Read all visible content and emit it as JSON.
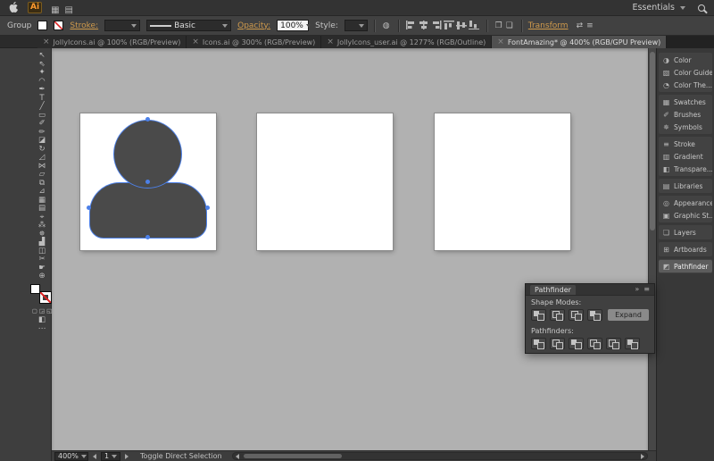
{
  "ui": {
    "close_glyph": "×"
  },
  "menubar": {
    "app_logo": "Ai",
    "workspace_label": "Essentials",
    "icons": [
      {
        "name": "arrange-documents-icon",
        "glyph": "▦"
      },
      {
        "name": "document-layout-icon",
        "glyph": "▤"
      }
    ]
  },
  "controlbar": {
    "context_label": "Group",
    "stroke_label": "Stroke:",
    "stroke_weight_value": "",
    "brush_definition": "Basic",
    "opacity_label": "Opacity:",
    "opacity_value": "100%",
    "style_label": "Style:",
    "transform_label": "Transform",
    "icons": [
      {
        "name": "recolor-artwork-icon",
        "glyph": "◍"
      }
    ],
    "align_icons": [
      {
        "name": "horizontal-align-left-icon"
      },
      {
        "name": "horizontal-align-center-icon"
      },
      {
        "name": "horizontal-align-right-icon"
      },
      {
        "name": "vertical-align-top-icon"
      },
      {
        "name": "vertical-align-center-icon"
      },
      {
        "name": "vertical-align-bottom-icon"
      }
    ],
    "doc_icons": [
      {
        "name": "align-to-artboard-icon",
        "glyph": "❐"
      },
      {
        "name": "distribute-objects-icon",
        "glyph": "❏"
      }
    ],
    "tail_icons": [
      {
        "name": "transform-options-icon",
        "glyph": "⇄"
      },
      {
        "name": "control-panel-menu-icon",
        "glyph": "≡"
      }
    ]
  },
  "tabs": [
    {
      "label": "JollyIcons.ai @ 100% (RGB/Preview)",
      "active": false
    },
    {
      "label": "Icons.ai @ 300% (RGB/Preview)",
      "active": false
    },
    {
      "label": "JollyIcons_user.ai @ 1277% (RGB/Outline)",
      "active": false
    },
    {
      "label": "FontAmazing* @ 400% (RGB/GPU Preview)",
      "active": true
    }
  ],
  "toolbar": {
    "tools": [
      {
        "name": "selection-tool",
        "glyph": "↖"
      },
      {
        "name": "direct-selection-tool",
        "glyph": "⇖"
      },
      {
        "name": "magic-wand-tool",
        "glyph": "✦"
      },
      {
        "name": "lasso-tool",
        "glyph": "◠"
      },
      {
        "name": "pen-tool",
        "glyph": "✒"
      },
      {
        "name": "type-tool",
        "glyph": "T"
      },
      {
        "name": "line-segment-tool",
        "glyph": "╱"
      },
      {
        "name": "rectangle-tool",
        "glyph": "▭"
      },
      {
        "name": "paintbrush-tool",
        "glyph": "✐"
      },
      {
        "name": "pencil-tool",
        "glyph": "✏"
      },
      {
        "name": "eraser-tool",
        "glyph": "◪"
      },
      {
        "name": "rotate-tool",
        "glyph": "↻"
      },
      {
        "name": "scale-tool",
        "glyph": "◿"
      },
      {
        "name": "width-tool",
        "glyph": "⋈"
      },
      {
        "name": "free-transform-tool",
        "glyph": "▱"
      },
      {
        "name": "shape-builder-tool",
        "glyph": "⧉"
      },
      {
        "name": "perspective-grid-tool",
        "glyph": "⊿"
      },
      {
        "name": "mesh-tool",
        "glyph": "▦"
      },
      {
        "name": "gradient-tool",
        "glyph": "▤"
      },
      {
        "name": "eyedropper-tool",
        "glyph": "⌖"
      },
      {
        "name": "blend-tool",
        "glyph": "⁂"
      },
      {
        "name": "symbol-sprayer-tool",
        "glyph": "✵"
      },
      {
        "name": "column-graph-tool",
        "glyph": "▟"
      },
      {
        "name": "artboard-tool",
        "glyph": "◫"
      },
      {
        "name": "slice-tool",
        "glyph": "✂"
      },
      {
        "name": "hand-tool",
        "glyph": "☛"
      },
      {
        "name": "zoom-tool",
        "glyph": "⊕"
      }
    ],
    "drawing_modes": [
      {
        "name": "draw-normal-mode-button",
        "glyph": "▢"
      },
      {
        "name": "draw-behind-mode-button",
        "glyph": "◲"
      },
      {
        "name": "draw-inside-mode-button",
        "glyph": "◱"
      }
    ],
    "extras": [
      {
        "name": "screen-mode-button",
        "glyph": "◧"
      },
      {
        "name": "edit-toolbar-button",
        "glyph": "⋯"
      }
    ]
  },
  "canvas": {
    "artboards": [
      {
        "name": "artboard-1",
        "has_user_icon": true
      },
      {
        "name": "artboard-2",
        "has_user_icon": false
      },
      {
        "name": "artboard-3",
        "has_user_icon": false
      }
    ],
    "colors": {
      "selection": "#4c80e8",
      "shape_fill": "#4a4a4a",
      "pasteboard": "#b1b1b1"
    }
  },
  "dock": {
    "groups": [
      {
        "items": [
          {
            "label": "Color",
            "name": "dock-item-color",
            "icon": "color-panel-icon",
            "glyph": "◑"
          },
          {
            "label": "Color Guide",
            "name": "dock-item-color-guide",
            "icon": "color-guide-icon",
            "glyph": "▧"
          },
          {
            "label": "Color The...",
            "name": "dock-item-color-themes",
            "icon": "color-themes-icon",
            "glyph": "◔"
          }
        ]
      },
      {
        "items": [
          {
            "label": "Swatches",
            "name": "dock-item-swatches",
            "icon": "swatches-icon",
            "glyph": "▦"
          },
          {
            "label": "Brushes",
            "name": "dock-item-brushes",
            "icon": "brushes-icon",
            "glyph": "✐"
          },
          {
            "label": "Symbols",
            "name": "dock-item-symbols",
            "icon": "symbols-icon",
            "glyph": "✵"
          }
        ]
      },
      {
        "items": [
          {
            "label": "Stroke",
            "name": "dock-item-stroke",
            "icon": "stroke-panel-icon",
            "glyph": "≡"
          },
          {
            "label": "Gradient",
            "name": "dock-item-gradient",
            "icon": "gradient-panel-icon",
            "glyph": "▥"
          },
          {
            "label": "Transpare...",
            "name": "dock-item-transparency",
            "icon": "transparency-icon",
            "glyph": "◧"
          }
        ]
      },
      {
        "items": [
          {
            "label": "Libraries",
            "name": "dock-item-libraries",
            "icon": "libraries-icon",
            "glyph": "▤"
          }
        ]
      },
      {
        "items": [
          {
            "label": "Appearance",
            "name": "dock-item-appearance",
            "icon": "appearance-icon",
            "glyph": "◎"
          },
          {
            "label": "Graphic St...",
            "name": "dock-item-graphic-styles",
            "icon": "graphic-styles-icon",
            "glyph": "▣"
          }
        ]
      },
      {
        "items": [
          {
            "label": "Layers",
            "name": "dock-item-layers",
            "icon": "layers-icon",
            "glyph": "❏"
          }
        ]
      },
      {
        "items": [
          {
            "label": "Artboards",
            "name": "dock-item-artboards",
            "icon": "artboards-icon",
            "glyph": "⊞"
          }
        ]
      },
      {
        "items": [
          {
            "label": "Pathfinder",
            "name": "dock-item-pathfinder",
            "icon": "pathfinder-icon",
            "glyph": "◩",
            "active": true
          }
        ]
      }
    ]
  },
  "pathfinder": {
    "title": "Pathfinder",
    "shape_modes_label": "Shape Modes:",
    "pathfinders_label": "Pathfinders:",
    "expand_label": "Expand",
    "header_icons": [
      {
        "name": "collapse-panel-icon",
        "glyph": "»"
      },
      {
        "name": "panel-menu-icon",
        "glyph": "≡"
      }
    ],
    "shape_modes": [
      {
        "name": "unite-button",
        "variant": "solid"
      },
      {
        "name": "minus-front-button",
        "variant": "hollow"
      },
      {
        "name": "intersect-button",
        "variant": "hollow"
      },
      {
        "name": "exclude-button",
        "variant": "solid"
      }
    ],
    "pathfinders": [
      {
        "name": "divide-button",
        "variant": "solid"
      },
      {
        "name": "trim-button",
        "variant": "hollow"
      },
      {
        "name": "merge-button",
        "variant": "solid"
      },
      {
        "name": "crop-button",
        "variant": "hollow"
      },
      {
        "name": "outline-button",
        "variant": "hollow"
      },
      {
        "name": "minus-back-button",
        "variant": "solid"
      }
    ]
  },
  "statusbar": {
    "zoom_value": "400%",
    "artboard_value": "1",
    "status_text": "Toggle Direct Selection"
  }
}
